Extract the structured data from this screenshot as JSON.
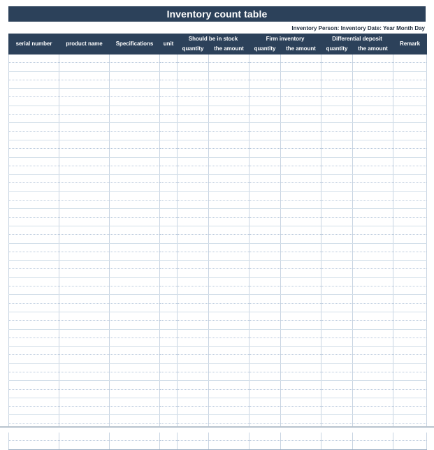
{
  "document": {
    "title": "Inventory count table",
    "meta_line": "Inventory Person: Inventory Date: Year Month Day"
  },
  "colors": {
    "header_navy": "#2c415a",
    "grid_line": "#c8d4e2",
    "page_background": "#ffffff",
    "bottom_strip": "#b8c3ce"
  },
  "table": {
    "columns": [
      {
        "key": "serial_number",
        "label": "serial number",
        "group": null
      },
      {
        "key": "product_name",
        "label": "product name",
        "group": null
      },
      {
        "key": "specifications",
        "label": "Specifications",
        "group": null
      },
      {
        "key": "unit",
        "label": "unit",
        "group": null
      },
      {
        "key": "stock_quantity",
        "label": "quantity",
        "group": "Should be in stock"
      },
      {
        "key": "stock_amount",
        "label": "the amount",
        "group": "Should be in stock"
      },
      {
        "key": "firm_quantity",
        "label": "quantity",
        "group": "Firm inventory"
      },
      {
        "key": "firm_amount",
        "label": "the amount",
        "group": "Firm inventory"
      },
      {
        "key": "diff_quantity",
        "label": "quantity",
        "group": "Differential deposit"
      },
      {
        "key": "diff_amount",
        "label": "the amount",
        "group": "Differential deposit"
      },
      {
        "key": "remark",
        "label": "Remark",
        "group": null
      }
    ],
    "group_headers": [
      {
        "label": "Should be in stock",
        "span": 2
      },
      {
        "label": "Firm inventory",
        "span": 2
      },
      {
        "label": "Differential deposit",
        "span": 2
      }
    ],
    "simple_headers": {
      "serial_number": "serial number",
      "product_name": "product name",
      "specifications": "Specifications",
      "unit": "unit",
      "remark": "Remark"
    },
    "sub_headers": {
      "quantity": "quantity",
      "the_amount": "the amount"
    },
    "body_row_count": 46,
    "rows": []
  }
}
